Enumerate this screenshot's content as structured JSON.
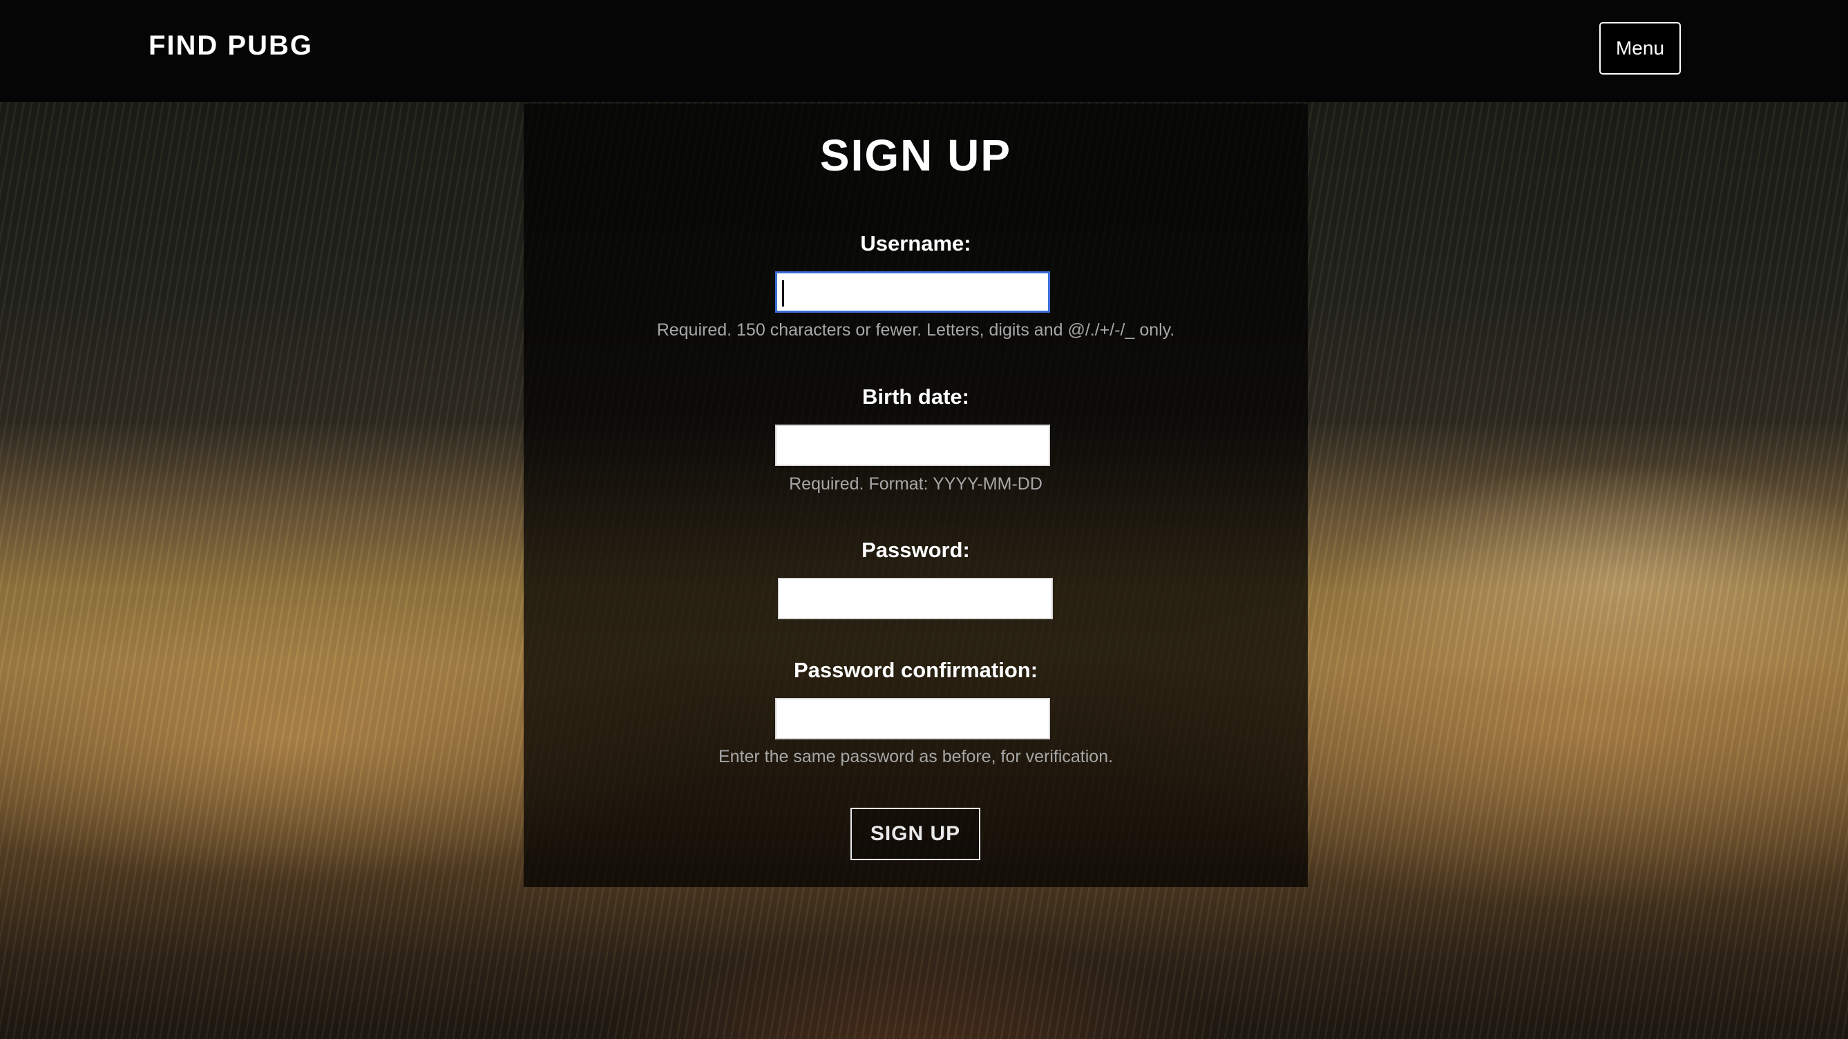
{
  "header": {
    "brand": "FIND PUBG",
    "menu_label": "Menu"
  },
  "form": {
    "title": "SIGN UP",
    "username": {
      "label": "Username:",
      "value": "",
      "help": "Required. 150 characters or fewer. Letters, digits and @/./+/-/_ only."
    },
    "birth_date": {
      "label": "Birth date:",
      "value": "",
      "help": "Required. Format: YYYY-MM-DD"
    },
    "password": {
      "label": "Password:",
      "value": ""
    },
    "password_confirmation": {
      "label": "Password confirmation:",
      "value": "",
      "help": "Enter the same password as before, for verification."
    },
    "submit_label": "SIGN UP"
  },
  "colors": {
    "focus_outline": "#3a6fd8",
    "help_text": "#a7a7a7",
    "panel": "rgba(0,0,0,0.72)"
  }
}
